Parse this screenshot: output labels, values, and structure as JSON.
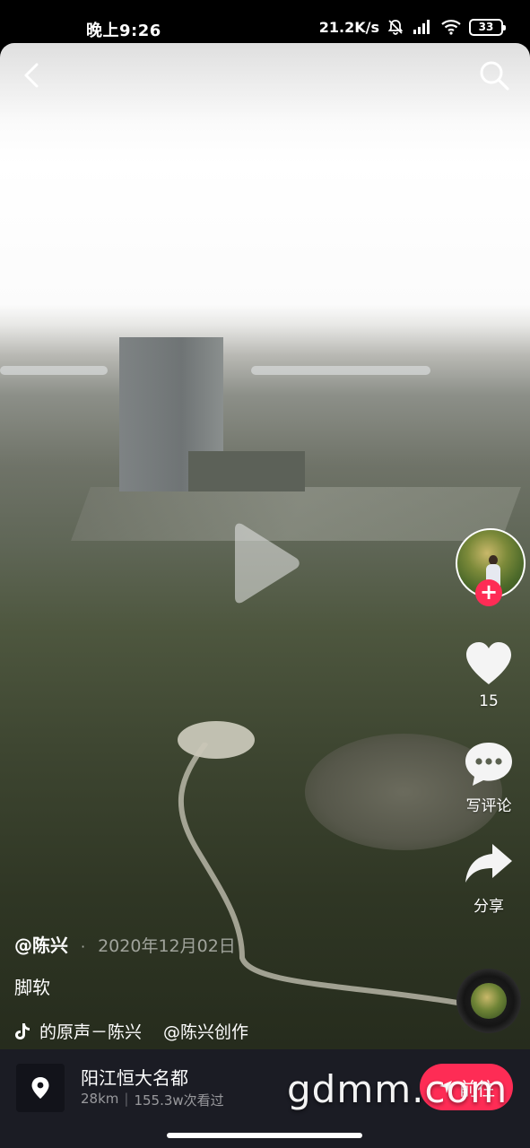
{
  "status_bar": {
    "time": "晚上9:26",
    "net_speed": "21.2K/s",
    "battery": "33"
  },
  "video": {
    "state": "paused"
  },
  "actions": {
    "like_count": "15",
    "comment_label": "写评论",
    "share_label": "分享"
  },
  "caption": {
    "author": "@陈兴",
    "separator": "·",
    "date": "2020年12月02日",
    "description": "脚软",
    "music_title": "的原声－陈兴",
    "music_creator": "@陈兴创作"
  },
  "location": {
    "name": "阳江恒大名都",
    "distance": "28km",
    "views": "155.3w次看过",
    "button_label": "前往"
  },
  "watermark": "gdmm.com",
  "colors": {
    "accent": "#fe2c55",
    "bar_bg": "#1b1c24"
  },
  "icons": [
    "back-arrow-icon",
    "search-icon",
    "play-icon",
    "heart-icon",
    "comment-icon",
    "share-arrow-icon",
    "music-note-icon",
    "location-pin-icon"
  ]
}
